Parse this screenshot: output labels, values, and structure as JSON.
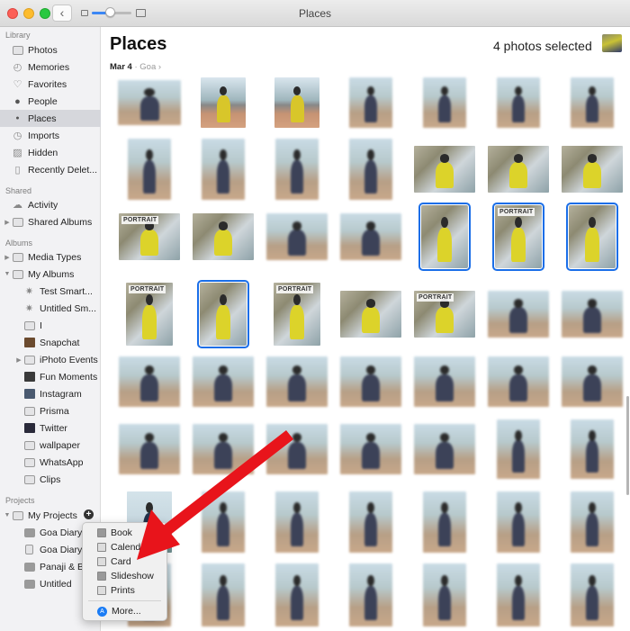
{
  "window": {
    "title": "Places",
    "back_label": "‹"
  },
  "zoom_slider": {
    "value_fraction": 0.45
  },
  "sidebar": {
    "sections": [
      {
        "header": "Library",
        "items": [
          {
            "label": "Photos",
            "icon": "photos-icon"
          },
          {
            "label": "Memories",
            "icon": "memories-icon"
          },
          {
            "label": "Favorites",
            "icon": "heart-icon"
          },
          {
            "label": "People",
            "icon": "person-icon"
          },
          {
            "label": "Places",
            "icon": "pin-icon",
            "selected": true
          },
          {
            "label": "Imports",
            "icon": "clock-icon"
          },
          {
            "label": "Hidden",
            "icon": "hidden-icon"
          },
          {
            "label": "Recently Delet...",
            "icon": "trash-icon"
          }
        ]
      },
      {
        "header": "Shared",
        "items": [
          {
            "label": "Activity",
            "icon": "cloud-icon"
          },
          {
            "label": "Shared Albums",
            "icon": "folder-icon",
            "disclosure": "collapsed"
          }
        ]
      },
      {
        "header": "Albums",
        "items": [
          {
            "label": "Media Types",
            "icon": "folder-icon",
            "disclosure": "collapsed"
          },
          {
            "label": "My Albums",
            "icon": "folder-icon",
            "disclosure": "expanded"
          },
          {
            "label": "Test Smart...",
            "icon": "gear-icon",
            "indent": 1
          },
          {
            "label": "Untitled Sm...",
            "icon": "gear-icon",
            "indent": 1
          },
          {
            "label": "I",
            "icon": "album-icon",
            "indent": 1
          },
          {
            "label": "Snapchat",
            "icon": "album-thumb-icon",
            "indent": 1
          },
          {
            "label": "iPhoto Events",
            "icon": "folder-icon",
            "indent": 1,
            "disclosure": "collapsed"
          },
          {
            "label": "Fun Moments",
            "icon": "album-thumb-icon",
            "indent": 1
          },
          {
            "label": "Instagram",
            "icon": "album-thumb-icon",
            "indent": 1
          },
          {
            "label": "Prisma",
            "icon": "album-icon",
            "indent": 1
          },
          {
            "label": "Twitter",
            "icon": "album-thumb-icon",
            "indent": 1
          },
          {
            "label": "wallpaper",
            "icon": "album-icon",
            "indent": 1
          },
          {
            "label": "WhatsApp",
            "icon": "album-icon",
            "indent": 1
          },
          {
            "label": "Clips",
            "icon": "album-icon",
            "indent": 1
          }
        ]
      },
      {
        "header": "Projects",
        "items": [
          {
            "label": "My Projects",
            "icon": "folder-icon",
            "disclosure": "expanded"
          },
          {
            "label": "Goa Diary",
            "icon": "book-icon",
            "indent": 1
          },
          {
            "label": "Goa Diary (",
            "icon": "card-icon",
            "indent": 1
          },
          {
            "label": "Panaji & Ba",
            "icon": "slideshow-icon",
            "indent": 1
          },
          {
            "label": "Untitled",
            "icon": "book-icon",
            "indent": 1
          }
        ]
      }
    ],
    "add_project_label": "+"
  },
  "main": {
    "title": "Places",
    "breadcrumb": {
      "date": "Mar 4",
      "separator": "·",
      "location": "Goa",
      "chevron": "›"
    },
    "selection_status": "4 photos selected",
    "badge_text": "PORTRAIT",
    "rows": [
      [
        {
          "t": "blur"
        },
        {
          "t": "beach"
        },
        {
          "t": "beach"
        },
        {
          "t": "blur"
        },
        {
          "t": "blur"
        },
        {
          "t": "blur"
        },
        {
          "t": "blur"
        }
      ],
      [
        {
          "t": "blur"
        },
        {
          "t": "blur"
        },
        {
          "t": "blur"
        },
        {
          "t": "blur"
        },
        {
          "t": "yellow"
        },
        {
          "t": "yellow"
        },
        {
          "t": "yellow"
        }
      ],
      [
        {
          "t": "yellow",
          "badge": true
        },
        {
          "t": "yellow"
        },
        {
          "t": "blur"
        },
        {
          "t": "blur"
        },
        {
          "t": "yellow",
          "sel": true
        },
        {
          "t": "yellow",
          "sel": true,
          "badge": true
        },
        {
          "t": "yellow",
          "sel": true
        }
      ],
      [
        {
          "t": "yellow",
          "badge": true
        },
        {
          "t": "yellow",
          "sel": true
        },
        {
          "t": "yellow",
          "badge": true
        },
        {
          "t": "yellow"
        },
        {
          "t": "yellow",
          "badge": true
        },
        {
          "t": "blur"
        },
        {
          "t": "blur"
        }
      ],
      [
        {
          "t": "blur"
        },
        {
          "t": "blur"
        },
        {
          "t": "blur"
        },
        {
          "t": "blur"
        },
        {
          "t": "blur"
        },
        {
          "t": "blur"
        },
        {
          "t": "blur"
        }
      ],
      [
        {
          "t": "blur"
        },
        {
          "t": "blur"
        },
        {
          "t": "blur"
        },
        {
          "t": "blur"
        },
        {
          "t": "blur"
        },
        {
          "t": "blur"
        },
        {
          "t": "blur"
        }
      ],
      [
        {
          "t": "sea"
        },
        {
          "t": "blur"
        },
        {
          "t": "blur"
        },
        {
          "t": "blur"
        },
        {
          "t": "blur"
        },
        {
          "t": "blur"
        },
        {
          "t": "blur"
        }
      ],
      [
        {
          "t": "blur"
        },
        {
          "t": "blur"
        },
        {
          "t": "blur"
        },
        {
          "t": "blur"
        },
        {
          "t": "blur"
        },
        {
          "t": "blur"
        },
        {
          "t": "blur"
        }
      ]
    ],
    "selected_count": 4
  },
  "create_menu": {
    "items": [
      {
        "label": "Book",
        "icon": "book-icon"
      },
      {
        "label": "Calendar",
        "icon": "calendar-icon"
      },
      {
        "label": "Card",
        "icon": "card-icon"
      },
      {
        "label": "Slideshow",
        "icon": "slideshow-icon"
      },
      {
        "label": "Prints",
        "icon": "prints-icon"
      }
    ],
    "more_label": "More...",
    "visible_partial_labels": {
      "1": "Calen"
    }
  },
  "annotation": {
    "type": "arrow",
    "color": "#e8141b",
    "points_to": "Card"
  }
}
